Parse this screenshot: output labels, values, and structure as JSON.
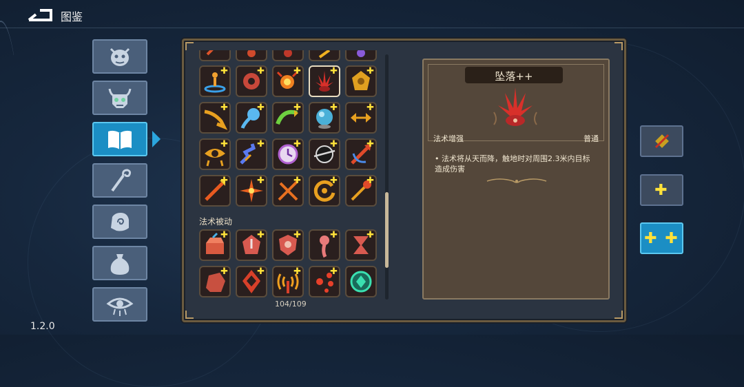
{
  "header": {
    "title": "图鉴"
  },
  "version": "1.2.0",
  "categories": [
    {
      "name": "monster-face"
    },
    {
      "name": "horned-skull"
    },
    {
      "name": "book",
      "active": true
    },
    {
      "name": "staff"
    },
    {
      "name": "hand-swirl"
    },
    {
      "name": "pouch"
    },
    {
      "name": "eye"
    }
  ],
  "grid": {
    "section_label": "法术被动",
    "counter": "104/109",
    "selected_index": 3
  },
  "detail": {
    "title": "坠落++",
    "type": "法术增强",
    "rarity": "普通",
    "description": "法术将从天而降，触地时对周围2.3米内目标造成伤害",
    "bullet": "•"
  },
  "side_buttons": [
    {
      "name": "no-upgrade",
      "label": ""
    },
    {
      "name": "single-plus",
      "label": "✚"
    },
    {
      "name": "double-plus",
      "label": "✚ ✚",
      "active": true
    }
  ],
  "colors": {
    "accent": "#1b8ec4",
    "plus": "#ffe23a",
    "panel": "#2b3441",
    "card": "#54473a"
  }
}
